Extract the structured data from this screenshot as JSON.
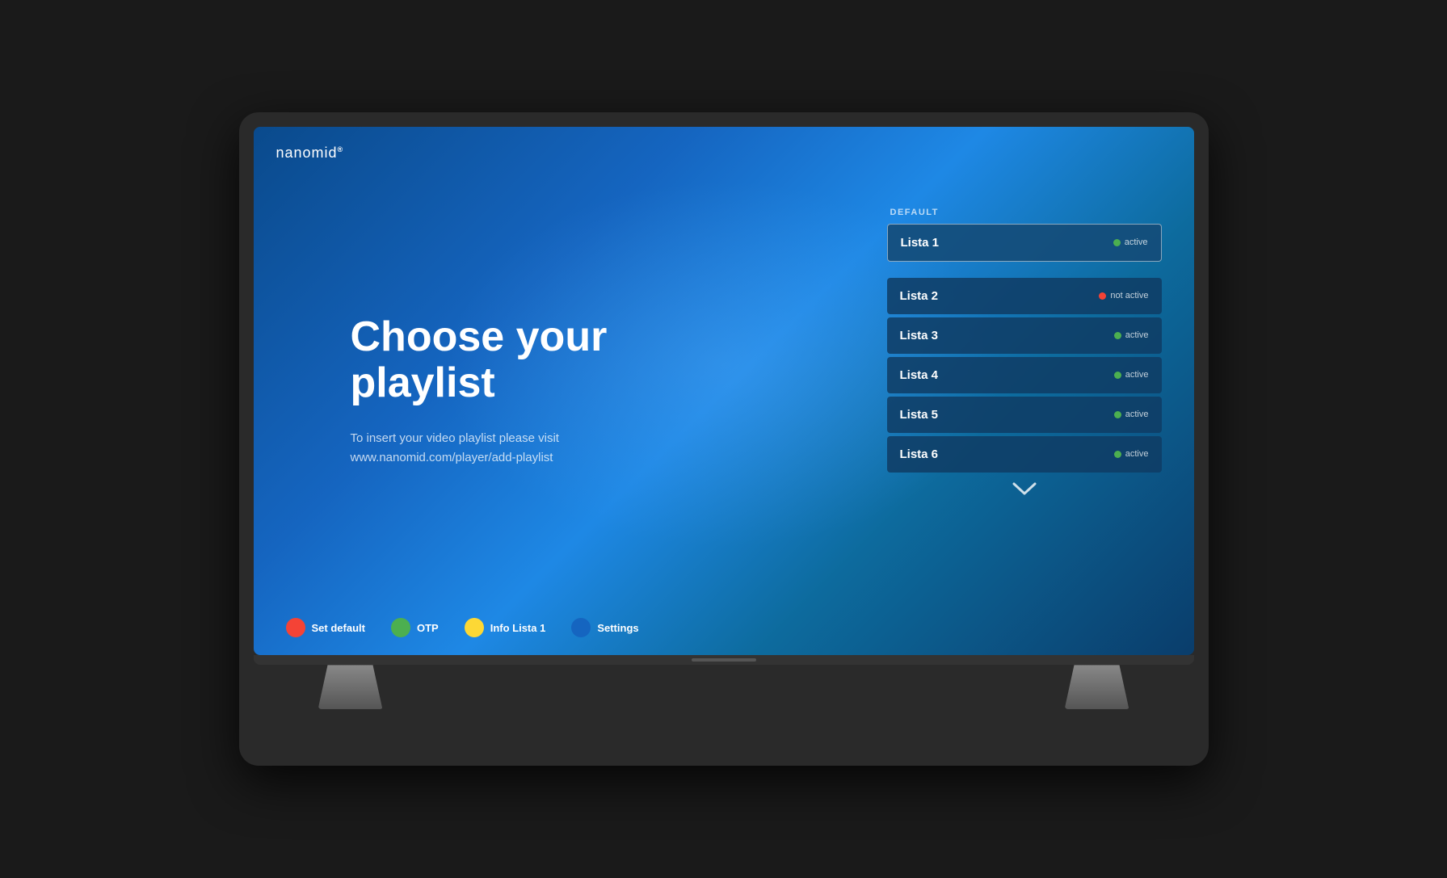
{
  "logo": {
    "text": "nanomid",
    "trademark": "®"
  },
  "main": {
    "title_line1": "Choose your",
    "title_line2": "playlist",
    "subtitle": "To insert your video playlist please visit\nwww.nanomid.com/player/add-playlist"
  },
  "default_section": {
    "label": "DEFAULT",
    "default_playlist": {
      "name": "Lista 1",
      "status": "active",
      "is_active": true
    }
  },
  "playlists": [
    {
      "name": "Lista 2",
      "status": "not active",
      "is_active": false
    },
    {
      "name": "Lista 3",
      "status": "active",
      "is_active": true
    },
    {
      "name": "Lista 4",
      "status": "active",
      "is_active": true
    },
    {
      "name": "Lista 5",
      "status": "active",
      "is_active": true
    },
    {
      "name": "Lista 6",
      "status": "active",
      "is_active": true
    }
  ],
  "scroll_indicator": "❯",
  "bottom_actions": [
    {
      "color": "#f44336",
      "label": "Set default"
    },
    {
      "color": "#4caf50",
      "label": "OTP"
    },
    {
      "color": "#fdd835",
      "label": "Info Lista 1"
    },
    {
      "color": "#1565c0",
      "label": "Settings"
    }
  ]
}
